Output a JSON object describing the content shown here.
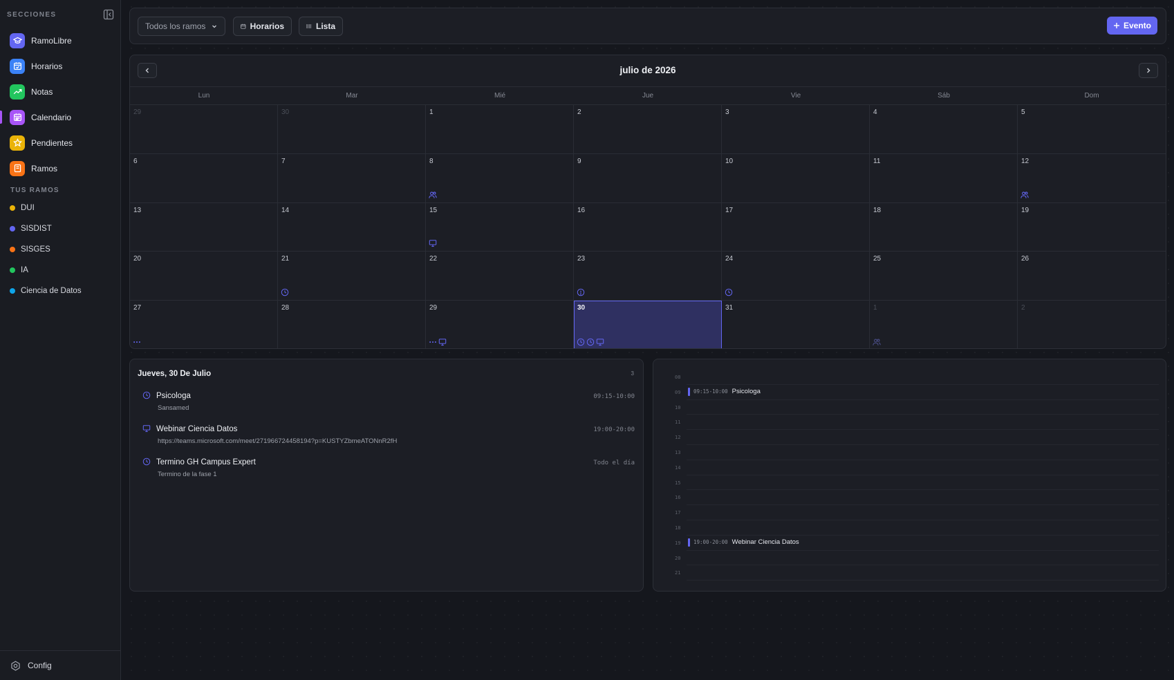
{
  "sidebar": {
    "title": "SECCIONES",
    "items": [
      {
        "label": "RamoLibre",
        "icon": "graduation-cap-icon",
        "color": "#6366f1",
        "active": false
      },
      {
        "label": "Horarios",
        "icon": "calendar-check-icon",
        "color": "#3b82f6",
        "active": false
      },
      {
        "label": "Notas",
        "icon": "trending-up-icon",
        "color": "#22c55e",
        "active": false
      },
      {
        "label": "Calendario",
        "icon": "calendar-icon",
        "color": "#a855f7",
        "active": true
      },
      {
        "label": "Pendientes",
        "icon": "star-icon",
        "color": "#eab308",
        "active": false
      },
      {
        "label": "Ramos",
        "icon": "book-icon",
        "color": "#f97316",
        "active": false
      }
    ],
    "ramos_title": "TUS RAMOS",
    "ramos": [
      {
        "label": "DUI",
        "color": "#eab308"
      },
      {
        "label": "SISDIST",
        "color": "#6366f1"
      },
      {
        "label": "SISGES",
        "color": "#f97316"
      },
      {
        "label": "IA",
        "color": "#22c55e"
      },
      {
        "label": "Ciencia de Datos",
        "color": "#0ea5e9"
      }
    ],
    "config_label": "Config"
  },
  "toolbar": {
    "filter_value": "Todos los ramos",
    "horarios_label": "Horarios",
    "lista_label": "Lista",
    "evento_label": "Evento"
  },
  "calendar": {
    "title": "julio de 2026",
    "weekdays": [
      "Lun",
      "Mar",
      "Mié",
      "Jue",
      "Vie",
      "Sáb",
      "Dom"
    ],
    "accent": "#6366f1",
    "days": [
      {
        "n": "29",
        "muted": true,
        "icons": []
      },
      {
        "n": "30",
        "muted": true,
        "icons": []
      },
      {
        "n": "1",
        "icons": []
      },
      {
        "n": "2",
        "icons": []
      },
      {
        "n": "3",
        "icons": []
      },
      {
        "n": "4",
        "icons": []
      },
      {
        "n": "5",
        "icons": []
      },
      {
        "n": "6",
        "icons": []
      },
      {
        "n": "7",
        "icons": []
      },
      {
        "n": "8",
        "icons": [
          "users"
        ]
      },
      {
        "n": "9",
        "icons": []
      },
      {
        "n": "10",
        "icons": []
      },
      {
        "n": "11",
        "icons": []
      },
      {
        "n": "12",
        "icons": [
          "users"
        ]
      },
      {
        "n": "13",
        "icons": []
      },
      {
        "n": "14",
        "icons": []
      },
      {
        "n": "15",
        "icons": [
          "monitor"
        ]
      },
      {
        "n": "16",
        "icons": []
      },
      {
        "n": "17",
        "icons": []
      },
      {
        "n": "18",
        "icons": []
      },
      {
        "n": "19",
        "icons": []
      },
      {
        "n": "20",
        "icons": []
      },
      {
        "n": "21",
        "icons": [
          "clock"
        ]
      },
      {
        "n": "22",
        "icons": []
      },
      {
        "n": "23",
        "icons": [
          "alert"
        ]
      },
      {
        "n": "24",
        "icons": [
          "clock"
        ]
      },
      {
        "n": "25",
        "icons": []
      },
      {
        "n": "26",
        "icons": []
      },
      {
        "n": "27",
        "icons": [
          "dots"
        ]
      },
      {
        "n": "28",
        "icons": []
      },
      {
        "n": "29",
        "icons": [
          "dots",
          "monitor"
        ]
      },
      {
        "n": "30",
        "selected": true,
        "icons": [
          "clock",
          "clock",
          "monitor"
        ]
      },
      {
        "n": "31",
        "icons": []
      },
      {
        "n": "1",
        "muted": true,
        "icons": [
          "users"
        ]
      },
      {
        "n": "2",
        "muted": true,
        "icons": []
      }
    ]
  },
  "day_panel": {
    "title": "Jueves, 30 De Julio",
    "count": "3",
    "events": [
      {
        "icon": "clock",
        "title": "Psicologa",
        "subtitle": "Sansamed",
        "time": "09:15-10:00"
      },
      {
        "icon": "monitor",
        "title": "Webinar Ciencia Datos",
        "subtitle": "https://teams.microsoft.com/meet/27196672445819​4?p=KUSTYZbmeATONnR2fH",
        "time": "19:00-20:00"
      },
      {
        "icon": "clock",
        "title": "Termino GH Campus Expert",
        "subtitle": "Termino de la fase 1",
        "time": "Todo el día"
      }
    ]
  },
  "timeline": {
    "hours": [
      "08",
      "09",
      "10",
      "11",
      "12",
      "13",
      "14",
      "15",
      "16",
      "17",
      "18",
      "19",
      "20",
      "21"
    ],
    "events": [
      {
        "hour": "09",
        "time": "09:15-10:00",
        "title": "Psicologa"
      },
      {
        "hour": "19",
        "time": "19:00-20:00",
        "title": "Webinar Ciencia Datos"
      }
    ]
  }
}
